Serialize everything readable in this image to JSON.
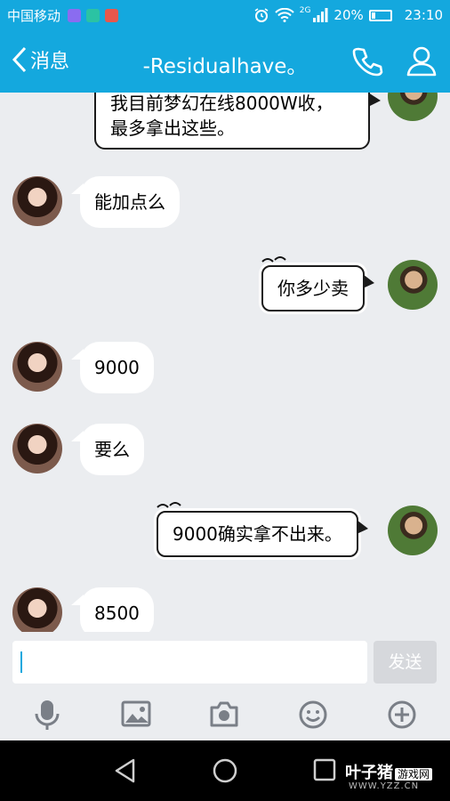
{
  "status_bar": {
    "carrier": "中国移动",
    "network": "2G",
    "battery": "20%",
    "battery_level": 0.2,
    "time": "23:10"
  },
  "header": {
    "back_label": "消息",
    "title": "-Residualhave。"
  },
  "messages": [
    {
      "side": "right",
      "style": "outline",
      "lines": [
        "我目前梦幻在线8000W收，",
        "最多拿出这些。"
      ]
    },
    {
      "side": "left",
      "style": "white",
      "text": "能加点么"
    },
    {
      "side": "right",
      "style": "outline",
      "text": "你多少卖"
    },
    {
      "side": "left",
      "style": "white",
      "text": "9000"
    },
    {
      "side": "left",
      "style": "white",
      "text": "要么"
    },
    {
      "side": "right",
      "style": "outline",
      "text": "9000确实拿不出来。"
    },
    {
      "side": "left",
      "style": "white",
      "text": "8500"
    }
  ],
  "input": {
    "value": "",
    "send_label": "发送"
  },
  "toolbar": [
    "mic-icon",
    "image-icon",
    "camera-icon",
    "emoji-icon",
    "plus-icon"
  ],
  "watermark": {
    "brand": "叶子猪",
    "tag": "游戏网",
    "url": "WWW.YZZ.CN"
  },
  "colors": {
    "accent": "#14a8de",
    "background": "#ebedf0"
  }
}
